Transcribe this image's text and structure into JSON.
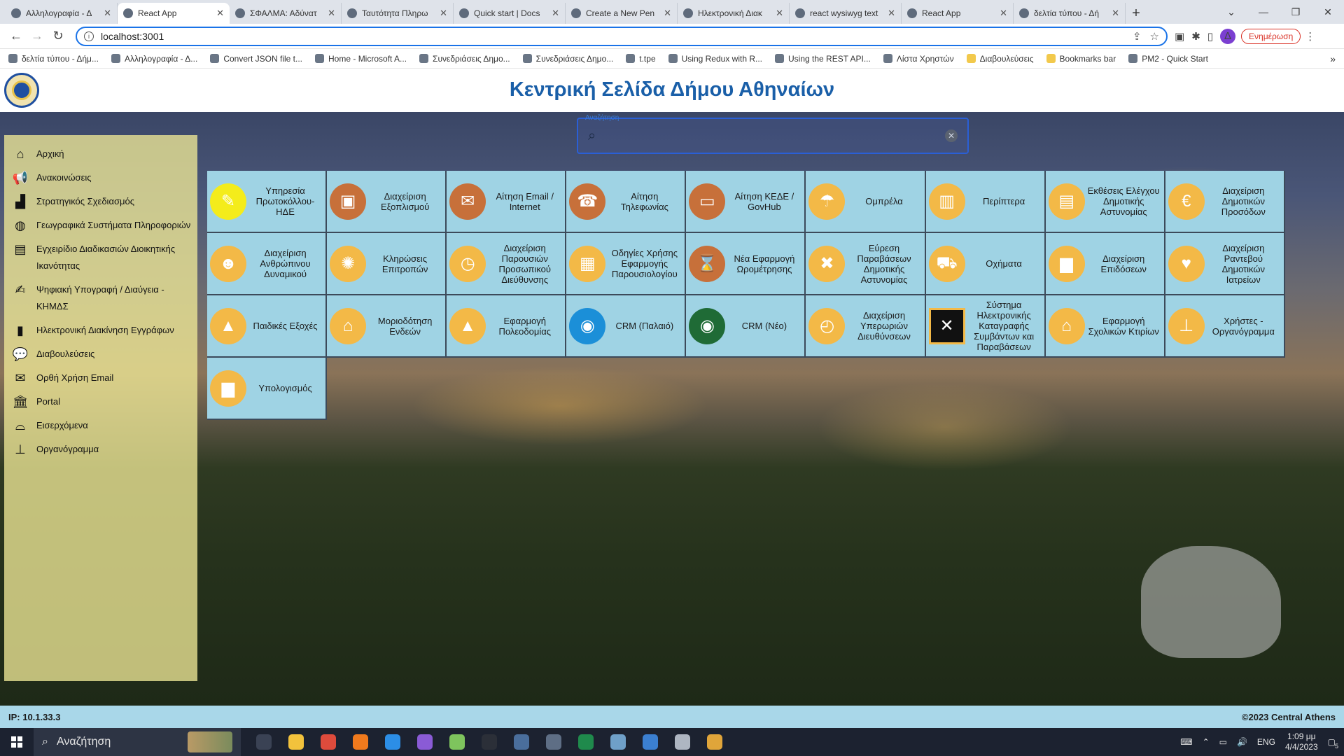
{
  "browser": {
    "tabs": [
      {
        "label": "Αλληλογραφία - Δ",
        "active": false
      },
      {
        "label": "React App",
        "active": true
      },
      {
        "label": "ΣΦΑΛΜΑ: Αδύνατ",
        "active": false
      },
      {
        "label": "Ταυτότητα Πληρω",
        "active": false
      },
      {
        "label": "Quick start | Docs",
        "active": false
      },
      {
        "label": "Create a New Pen",
        "active": false
      },
      {
        "label": "Ηλεκτρονική Διακ",
        "active": false
      },
      {
        "label": "react wysiwyg text",
        "active": false
      },
      {
        "label": "React App",
        "active": false
      },
      {
        "label": "δελτία τύπου - Δή",
        "active": false
      }
    ],
    "url": "localhost:3001",
    "update_label": "Ενημέρωση",
    "profile_initial": "Δ",
    "bookmarks": [
      {
        "label": "δελτία τύπου - Δήμ...",
        "folder": false
      },
      {
        "label": "Αλληλογραφία - Δ...",
        "folder": false
      },
      {
        "label": "Convert JSON file t...",
        "folder": false
      },
      {
        "label": "Home - Microsoft A...",
        "folder": false
      },
      {
        "label": "Συνεδριάσεις Δημο...",
        "folder": false
      },
      {
        "label": "Συνεδριάσεις Δημο...",
        "folder": false
      },
      {
        "label": "t.tpe",
        "folder": false
      },
      {
        "label": "Using Redux with R...",
        "folder": false
      },
      {
        "label": "Using the REST API...",
        "folder": false
      },
      {
        "label": "Λίστα Χρηστών",
        "folder": false
      },
      {
        "label": "Διαβουλεύσεις",
        "folder": true
      },
      {
        "label": "Bookmarks bar",
        "folder": true
      },
      {
        "label": "PM2 - Quick Start",
        "folder": false
      }
    ]
  },
  "header": {
    "title": "Κεντρική Σελίδα Δήμου Αθηναίων"
  },
  "search": {
    "label": "Αναζήτηση",
    "value": ""
  },
  "sidebar": {
    "items": [
      {
        "label": "Αρχική",
        "icon": "home-icon",
        "glyph": "⌂"
      },
      {
        "label": "Ανακοινώσεις",
        "icon": "megaphone-icon",
        "glyph": "📢"
      },
      {
        "label": "Στρατηγικός Σχεδιασμός",
        "icon": "chart-area-icon",
        "glyph": "▟"
      },
      {
        "label": "Γεωγραφικά Συστήματα Πληροφοριών",
        "icon": "globe-icon",
        "glyph": "◍"
      },
      {
        "label": "Εγχειρίδιο Διαδικασιών Διοικητικής Ικανότητας",
        "icon": "book-icon",
        "glyph": "▤"
      },
      {
        "label": "Ψηφιακή Υπογραφή / Διαύγεια - ΚΗΜΔΣ",
        "icon": "signature-icon",
        "glyph": "✍"
      },
      {
        "label": "Ηλεκτρονική Διακίνηση Εγγράφων",
        "icon": "file-icon",
        "glyph": "▮"
      },
      {
        "label": "Διαβουλεύσεις",
        "icon": "comments-icon",
        "glyph": "💬"
      },
      {
        "label": "Ορθή Χρήση Email",
        "icon": "envelope-icon",
        "glyph": "✉"
      },
      {
        "label": "Portal",
        "icon": "institution-icon",
        "glyph": "🏛"
      },
      {
        "label": "Εισερχόμενα",
        "icon": "inbox-icon",
        "glyph": "⌓"
      },
      {
        "label": "Οργανόγραμμα",
        "icon": "sitemap-icon",
        "glyph": "⊥"
      }
    ]
  },
  "apps": [
    {
      "label": "Υπηρεσία Πρωτοκόλλου-ΗΔΕ",
      "icon": "folder-icon",
      "style": "yellow",
      "glyph": "✎"
    },
    {
      "label": "Διαχείριση Εξοπλισμού",
      "icon": "monitor-icon",
      "style": "brown",
      "glyph": "▣"
    },
    {
      "label": "Αίτηση Email / Internet",
      "icon": "email-request-icon",
      "style": "brown",
      "glyph": "✉"
    },
    {
      "label": "Αίτηση Τηλεφωνίας",
      "icon": "telephone-icon",
      "style": "brown",
      "glyph": "☎"
    },
    {
      "label": "Αίτηση ΚΕΔΕ / GovHub",
      "icon": "gov-icon",
      "style": "brown",
      "glyph": "▭"
    },
    {
      "label": "Ομπρέλα",
      "icon": "umbrella-icon",
      "style": "gold",
      "glyph": "☂"
    },
    {
      "label": "Περίπτερα",
      "icon": "kiosk-icon",
      "style": "gold",
      "glyph": "▥"
    },
    {
      "label": "Εκθέσεις Ελέγχου Δημοτικής Αστυνομίας",
      "icon": "report-icon",
      "style": "gold",
      "glyph": "▤"
    },
    {
      "label": "Διαχείριση Δημοτικών Προσόδων",
      "icon": "euro-icon",
      "style": "gold",
      "glyph": "€"
    },
    {
      "label": "Διαχείριση Ανθρώπινου Δυναμικού",
      "icon": "people-icon",
      "style": "gold",
      "glyph": "☻"
    },
    {
      "label": "Κληρώσεις Επιτροπών",
      "icon": "wheel-icon",
      "style": "gold",
      "glyph": "✺"
    },
    {
      "label": "Διαχείριση Παρουσιών Προσωπικού Διεύθυνσης",
      "icon": "stopwatch-icon",
      "style": "gold",
      "glyph": "◷"
    },
    {
      "label": "Οδηγίες Χρήσης Εφαρμογής Παρουσιολογίου",
      "icon": "guide-icon",
      "style": "gold",
      "glyph": "▦"
    },
    {
      "label": "Νέα Εφαρμογή Ωρομέτρησης",
      "icon": "hourglass-icon",
      "style": "brown",
      "glyph": "⌛"
    },
    {
      "label": "Εύρεση Παραβάσεων Δημοτικής Αστυνομίας",
      "icon": "violation-icon",
      "style": "gold",
      "glyph": "✖"
    },
    {
      "label": "Οχήματα",
      "icon": "car-icon",
      "style": "gold",
      "glyph": "⛟"
    },
    {
      "label": "Διαχείριση Επιδόσεων",
      "icon": "bar-chart-icon",
      "style": "gold",
      "glyph": "▆"
    },
    {
      "label": "Διαχείριση Ραντεβού Δημοτικών Ιατρείων",
      "icon": "heart-plus-icon",
      "style": "gold",
      "glyph": "♥"
    },
    {
      "label": "Παιδικές Εξοχές",
      "icon": "camp-icon",
      "style": "gold",
      "glyph": "▲"
    },
    {
      "label": "Μοριοδότηση Ενδεών",
      "icon": "house-plus-icon",
      "style": "gold",
      "glyph": "⌂"
    },
    {
      "label": "Εφαρμογή Πολεοδομίας",
      "icon": "buildings-icon",
      "style": "gold",
      "glyph": "▲"
    },
    {
      "label": "CRM (Παλαιό)",
      "icon": "crm-old-icon",
      "style": "blue",
      "glyph": "◉"
    },
    {
      "label": "CRM (Νέο)",
      "icon": "crm-new-icon",
      "style": "green",
      "glyph": "◉"
    },
    {
      "label": "Διαχείριση Υπερωριών Διευθύνσεων",
      "icon": "overtime-clock-icon",
      "style": "gold",
      "glyph": "◴"
    },
    {
      "label": "Σύστημα Ηλεκτρονικής Καταγραφής Συμβάντων και Παραβάσεων",
      "icon": "incident-icon",
      "style": "black",
      "glyph": "✕"
    },
    {
      "label": "Εφαρμογή Σχολικών Κτιρίων",
      "icon": "school-icon",
      "style": "gold",
      "glyph": "⌂"
    },
    {
      "label": "Χρήστες - Οργανόγραμμα",
      "icon": "org-chart-icon",
      "style": "gold",
      "glyph": "⊥"
    },
    {
      "label": "Υπολογισμός",
      "icon": "calculation-icon",
      "style": "gold",
      "glyph": "▆"
    }
  ],
  "footer": {
    "ip": "IP:  10.1.33.3",
    "copyright": "©2023 Central Athens"
  },
  "taskbar": {
    "search_label": "Αναζήτηση",
    "language": "ENG",
    "time": "1:09 μμ",
    "date": "4/4/2023",
    "notification_count": "5",
    "apps": [
      {
        "name": "task-view-icon",
        "color": "#3a4254"
      },
      {
        "name": "file-explorer-icon",
        "color": "#f2c23c"
      },
      {
        "name": "chrome-icon",
        "color": "#de4b3c"
      },
      {
        "name": "firefox-icon",
        "color": "#f07a1d"
      },
      {
        "name": "vscode-icon",
        "color": "#2c8ee6"
      },
      {
        "name": "visual-studio-icon",
        "color": "#8a5bd6"
      },
      {
        "name": "notepad-plus-icon",
        "color": "#7ec45d"
      },
      {
        "name": "terminal-icon",
        "color": "#2b2f38"
      },
      {
        "name": "sql-server-icon",
        "color": "#4a6e9c"
      },
      {
        "name": "calculator-icon",
        "color": "#5e6e85"
      },
      {
        "name": "excel-icon",
        "color": "#1f8a4c"
      },
      {
        "name": "steam-icon",
        "color": "#6fa0c8"
      },
      {
        "name": "remote-desktop-icon",
        "color": "#3b7fd0"
      },
      {
        "name": "settings-icon",
        "color": "#aeb6c2"
      },
      {
        "name": "chrome-alt-icon",
        "color": "#e0a53a"
      }
    ]
  }
}
